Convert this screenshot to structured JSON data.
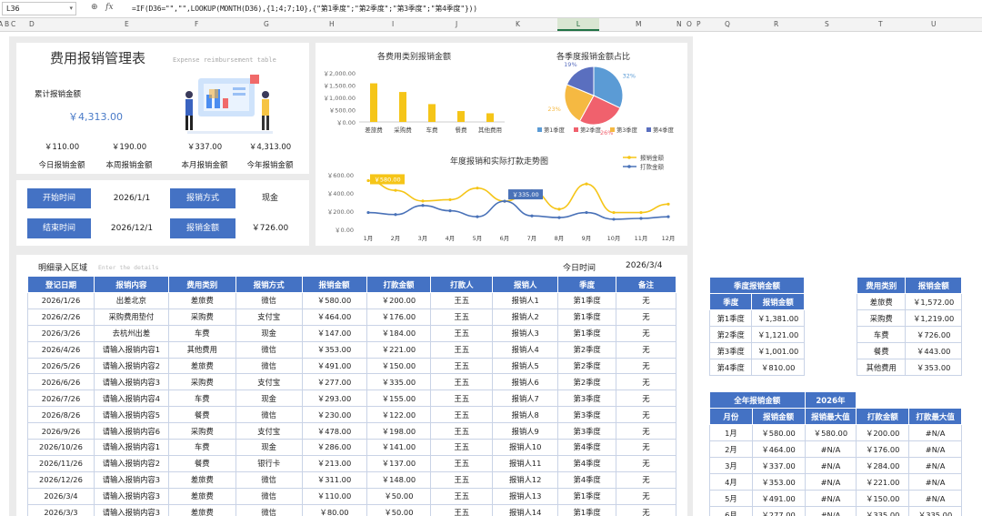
{
  "sheet": {
    "cell_ref": "L36",
    "formula": "=IF(D36=\"\",\"\",LOOKUP(MONTH(D36),{1;4;7;10},{\"第1季度\";\"第2季度\";\"第3季度\";\"第4季度\"}))",
    "columns": [
      "A",
      "B",
      "C",
      "D",
      "E",
      "F",
      "G",
      "H",
      "I",
      "J",
      "K",
      "L",
      "M",
      "N",
      "O",
      "P",
      "Q",
      "R",
      "S",
      "T",
      "U"
    ]
  },
  "header": {
    "title": "费用报销管理表",
    "subtitle": "Expense reimbursement table",
    "total_label": "累计报销金额",
    "total_value": "￥4,313.00",
    "kpis": [
      {
        "value": "￥110.00",
        "label": "今日报销金额"
      },
      {
        "value": "￥190.00",
        "label": "本周报销金额"
      },
      {
        "value": "￥337.00",
        "label": "本月报销金额"
      },
      {
        "value": "￥4,313.00",
        "label": "今年报销金额"
      }
    ]
  },
  "filters": {
    "start_label": "开始时间",
    "start_value": "2026/1/1",
    "method_label": "报销方式",
    "method_value": "现金",
    "end_label": "结束时间",
    "end_value": "2026/12/1",
    "amount_label": "报销金额",
    "amount_value": "￥726.00"
  },
  "chart_data": [
    {
      "type": "bar",
      "title": "各费用类别报销金额",
      "categories": [
        "差旅费",
        "采购费",
        "车费",
        "餐费",
        "其他费用"
      ],
      "values": [
        1572,
        1219,
        726,
        443,
        353
      ],
      "yticks": [
        "￥2,000.00",
        "￥1,500.00",
        "￥1,000.00",
        "￥500.00",
        "￥0.00"
      ],
      "ylim": [
        0,
        2000
      ],
      "color": "#f5c518"
    },
    {
      "type": "pie",
      "title": "各季度报销金额占比",
      "categories": [
        "第1季度",
        "第2季度",
        "第3季度",
        "第4季度"
      ],
      "values": [
        1381,
        1121,
        1001,
        810
      ],
      "percent_labels": [
        "32%",
        "26%",
        "23%",
        "19%"
      ],
      "colors": [
        "#5b9bd5",
        "#f0616d",
        "#f5b942",
        "#5a6fbf"
      ]
    },
    {
      "type": "line",
      "title": "年度报销和实际打款走势图",
      "categories": [
        "1月",
        "2月",
        "3月",
        "4月",
        "5月",
        "6月",
        "7月",
        "8月",
        "9月",
        "10月",
        "11月",
        "12月"
      ],
      "series": [
        {
          "name": "报销金额",
          "values": [
            580,
            464,
            337,
            353,
            491,
            335,
            460,
            240,
            540,
            200,
            200,
            300
          ],
          "color": "#f5c518"
        },
        {
          "name": "打款金额",
          "values": [
            200,
            176,
            284,
            221,
            150,
            335,
            160,
            140,
            200,
            120,
            130,
            150
          ],
          "color": "#4a72b8"
        }
      ],
      "callouts": [
        "￥580.00",
        "￥335.00"
      ],
      "yticks": [
        "￥600.00",
        "￥400.00",
        "￥200.00",
        "￥0.00"
      ],
      "ylim": [
        0,
        650
      ]
    }
  ],
  "details": {
    "label": "明细录入区域",
    "sublabel": "Enter the details",
    "today_label": "今日时间",
    "today_value": "2026/3/4",
    "headers": [
      "登记日期",
      "报销内容",
      "费用类别",
      "报销方式",
      "报销金额",
      "打款金额",
      "打款人",
      "报销人",
      "季度",
      "备注"
    ],
    "rows": [
      [
        "2026/1/26",
        "出差北京",
        "差旅费",
        "微信",
        "￥580.00",
        "￥200.00",
        "王五",
        "报销人1",
        "第1季度",
        "无"
      ],
      [
        "2026/2/26",
        "采购费用垫付",
        "采购费",
        "支付宝",
        "￥464.00",
        "￥176.00",
        "王五",
        "报销人2",
        "第1季度",
        "无"
      ],
      [
        "2026/3/26",
        "去杭州出差",
        "车费",
        "现金",
        "￥147.00",
        "￥184.00",
        "王五",
        "报销人3",
        "第1季度",
        "无"
      ],
      [
        "2026/4/26",
        "请输入报销内容1",
        "其他费用",
        "微信",
        "￥353.00",
        "￥221.00",
        "王五",
        "报销人4",
        "第2季度",
        "无"
      ],
      [
        "2026/5/26",
        "请输入报销内容2",
        "差旅费",
        "微信",
        "￥491.00",
        "￥150.00",
        "王五",
        "报销人5",
        "第2季度",
        "无"
      ],
      [
        "2026/6/26",
        "请输入报销内容3",
        "采购费",
        "支付宝",
        "￥277.00",
        "￥335.00",
        "王五",
        "报销人6",
        "第2季度",
        "无"
      ],
      [
        "2026/7/26",
        "请输入报销内容4",
        "车费",
        "现金",
        "￥293.00",
        "￥155.00",
        "王五",
        "报销人7",
        "第3季度",
        "无"
      ],
      [
        "2026/8/26",
        "请输入报销内容5",
        "餐费",
        "微信",
        "￥230.00",
        "￥122.00",
        "王五",
        "报销人8",
        "第3季度",
        "无"
      ],
      [
        "2026/9/26",
        "请输入报销内容6",
        "采购费",
        "支付宝",
        "￥478.00",
        "￥198.00",
        "王五",
        "报销人9",
        "第3季度",
        "无"
      ],
      [
        "2026/10/26",
        "请输入报销内容1",
        "车费",
        "现金",
        "￥286.00",
        "￥141.00",
        "王五",
        "报销人10",
        "第4季度",
        "无"
      ],
      [
        "2026/11/26",
        "请输入报销内容2",
        "餐费",
        "银行卡",
        "￥213.00",
        "￥137.00",
        "王五",
        "报销人11",
        "第4季度",
        "无"
      ],
      [
        "2026/12/26",
        "请输入报销内容3",
        "差旅费",
        "微信",
        "￥311.00",
        "￥148.00",
        "王五",
        "报销人12",
        "第4季度",
        "无"
      ],
      [
        "2026/3/4",
        "请输入报销内容3",
        "差旅费",
        "微信",
        "￥110.00",
        "￥50.00",
        "王五",
        "报销人13",
        "第1季度",
        "无"
      ],
      [
        "2026/3/3",
        "请输入报销内容3",
        "差旅费",
        "微信",
        "￥80.00",
        "￥50.00",
        "王五",
        "报销人14",
        "第1季度",
        "无"
      ]
    ]
  },
  "quarter_table": {
    "title": "季度报销金额",
    "headers": [
      "季度",
      "报销金额"
    ],
    "rows": [
      [
        "第1季度",
        "￥1,381.00"
      ],
      [
        "第2季度",
        "￥1,121.00"
      ],
      [
        "第3季度",
        "￥1,001.00"
      ],
      [
        "第4季度",
        "￥810.00"
      ]
    ]
  },
  "category_table": {
    "headers": [
      "费用类别",
      "报销金额"
    ],
    "rows": [
      [
        "差旅费",
        "￥1,572.00"
      ],
      [
        "采购费",
        "￥1,219.00"
      ],
      [
        "车费",
        "￥726.00"
      ],
      [
        "餐费",
        "￥443.00"
      ],
      [
        "其他费用",
        "￥353.00"
      ]
    ]
  },
  "year_table": {
    "title": "全年报销金额",
    "year": "2026年",
    "headers": [
      "月份",
      "报销金额",
      "报销最大值",
      "打款金额",
      "打款最大值"
    ],
    "rows": [
      [
        "1月",
        "￥580.00",
        "￥580.00",
        "￥200.00",
        "#N/A"
      ],
      [
        "2月",
        "￥464.00",
        "#N/A",
        "￥176.00",
        "#N/A"
      ],
      [
        "3月",
        "￥337.00",
        "#N/A",
        "￥284.00",
        "#N/A"
      ],
      [
        "4月",
        "￥353.00",
        "#N/A",
        "￥221.00",
        "#N/A"
      ],
      [
        "5月",
        "￥491.00",
        "#N/A",
        "￥150.00",
        "#N/A"
      ],
      [
        "6月",
        "￥277.00",
        "#N/A",
        "￥335.00",
        "￥335.00"
      ]
    ]
  }
}
